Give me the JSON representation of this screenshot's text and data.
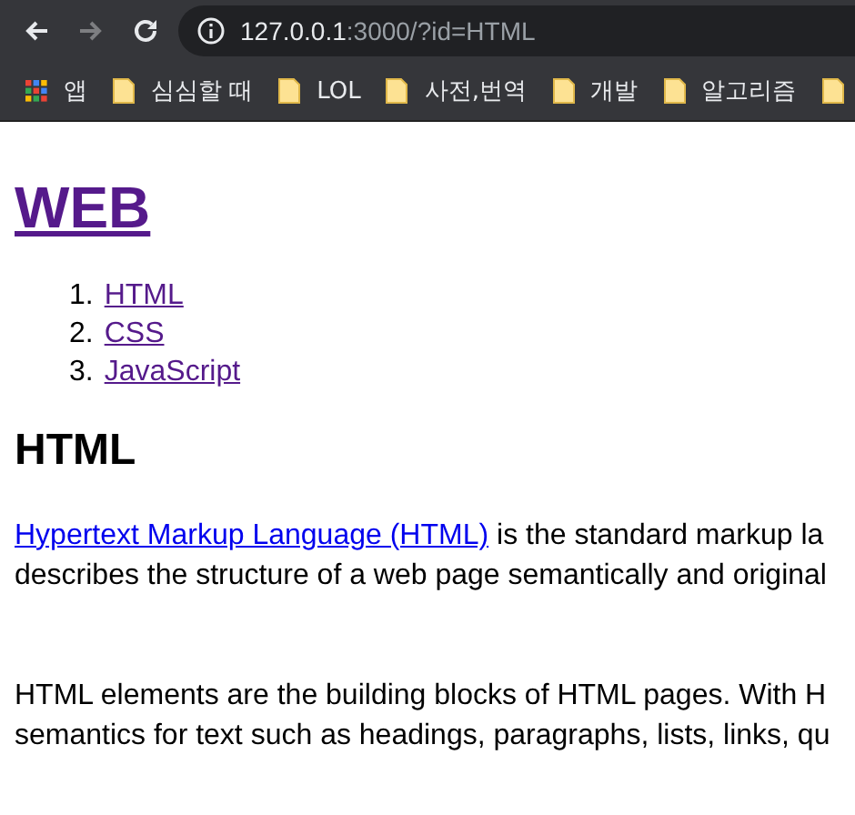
{
  "browser": {
    "nav_buttons": [
      {
        "kind": "back",
        "disabled": false
      },
      {
        "kind": "forward",
        "disabled": true
      },
      {
        "kind": "reload",
        "disabled": false
      }
    ],
    "address": {
      "host": "127.0.0.1",
      "rest": ":3000/?id=HTML"
    }
  },
  "bookmarks": [
    {
      "kind": "apps",
      "label": "앱"
    },
    {
      "kind": "folder",
      "label": "심심할 때"
    },
    {
      "kind": "folder",
      "label": "LOL"
    },
    {
      "kind": "folder",
      "label": "사전,번역"
    },
    {
      "kind": "folder",
      "label": "개발"
    },
    {
      "kind": "folder",
      "label": "알고리즘"
    },
    {
      "kind": "folder"
    }
  ],
  "page": {
    "title": {
      "text": "WEB",
      "visited": true
    },
    "nav": [
      {
        "number": "1.",
        "label": "HTML",
        "visited": true
      },
      {
        "number": "2.",
        "label": "CSS",
        "visited": true
      },
      {
        "number": "3.",
        "label": "JavaScript",
        "visited": true
      }
    ],
    "heading": "HTML",
    "paragraphs": [
      {
        "lines": [
          {
            "link": "Hypertext Markup Language (HTML)",
            "visited": false,
            "text": " is the standard markup la"
          },
          {
            "text": "describes the structure of a web page semantically and original"
          }
        ]
      },
      {
        "lines": [
          {
            "text": "HTML elements are the building blocks of HTML pages. With H"
          },
          {
            "text": "semantics for text such as headings, paragraphs, lists, links, qu"
          }
        ]
      }
    ]
  }
}
